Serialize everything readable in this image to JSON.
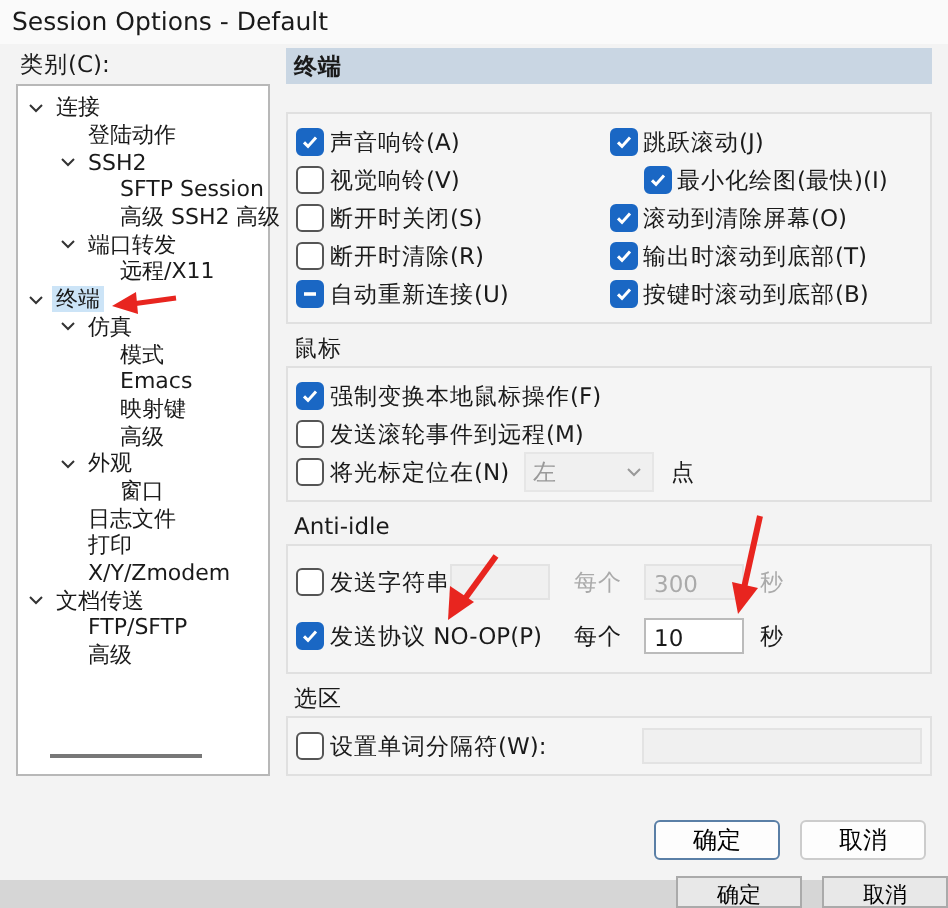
{
  "window": {
    "title": "Session Options - Default"
  },
  "category_label": "类别(C):",
  "tree": [
    {
      "label": "连接",
      "selected": false,
      "expanded": true,
      "children": [
        {
          "label": "登陆动作",
          "selected": false
        },
        {
          "label": "SSH2",
          "selected": false,
          "expanded": true,
          "children": [
            {
              "label": "SFTP Session",
              "selected": false
            },
            {
              "label": "高级 SSH2 高级",
              "selected": false
            }
          ]
        },
        {
          "label": "端口转发",
          "selected": false,
          "expanded": true,
          "children": [
            {
              "label": "远程/X11",
              "selected": false
            }
          ]
        }
      ]
    },
    {
      "label": "终端",
      "selected": true,
      "expanded": true,
      "children": [
        {
          "label": "仿真",
          "selected": false,
          "expanded": true,
          "children": [
            {
              "label": "模式",
              "selected": false
            },
            {
              "label": "Emacs",
              "selected": false
            },
            {
              "label": "映射键",
              "selected": false
            },
            {
              "label": "高级",
              "selected": false
            }
          ]
        },
        {
          "label": "外观",
          "selected": false,
          "expanded": true,
          "children": [
            {
              "label": "窗口",
              "selected": false
            }
          ]
        },
        {
          "label": "日志文件",
          "selected": false
        },
        {
          "label": "打印",
          "selected": false
        },
        {
          "label": "X/Y/Zmodem",
          "selected": false
        }
      ]
    },
    {
      "label": "文档传送",
      "selected": false,
      "expanded": true,
      "children": [
        {
          "label": "FTP/SFTP",
          "selected": false
        },
        {
          "label": "高级",
          "selected": false
        }
      ]
    }
  ],
  "panel_title": "终端",
  "terminal_options": {
    "left": [
      {
        "label": "声音响铃(A)",
        "checked": true
      },
      {
        "label": "视觉响铃(V)",
        "checked": false
      },
      {
        "label": "断开时关闭(S)",
        "checked": false
      },
      {
        "label": "断开时清除(R)",
        "checked": false
      },
      {
        "label": "自动重新连接(U)",
        "indeterminate": true
      }
    ],
    "right": [
      {
        "label": "跳跃滚动(J)",
        "checked": true,
        "children": [
          {
            "label": "最小化绘图(最快)(I)",
            "checked": true
          }
        ]
      },
      {
        "label": "滚动到清除屏幕(O)",
        "checked": true
      },
      {
        "label": "输出时滚动到底部(T)",
        "checked": true
      },
      {
        "label": "按键时滚动到底部(B)",
        "checked": true
      }
    ]
  },
  "mouse": {
    "title": "鼠标",
    "options": [
      {
        "label": "强制变换本地鼠标操作(F)",
        "checked": true
      },
      {
        "label": "发送滚轮事件到远程(M)",
        "checked": false
      },
      {
        "label": "将光标定位在(N)",
        "checked": false,
        "dropdown": {
          "value": "左",
          "disabled": true
        },
        "suffix": "点"
      }
    ]
  },
  "anti_idle": {
    "title": "Anti-idle",
    "rows": [
      {
        "label": "发送字符串",
        "checked": false,
        "text_value": "",
        "every": "每个",
        "interval": "300",
        "unit": "秒",
        "disabled": true
      },
      {
        "label": "发送协议 NO-OP(P)",
        "checked": true,
        "every": "每个",
        "interval": "10",
        "unit": "秒",
        "disabled": false
      }
    ]
  },
  "selection": {
    "title": "选区",
    "option": {
      "label": "设置单词分隔符(W):",
      "checked": false
    }
  },
  "buttons": [
    {
      "label": "确定",
      "default": true
    },
    {
      "label": "取消",
      "default": false
    }
  ],
  "background_window_buttons": [
    "确定",
    "取消"
  ]
}
